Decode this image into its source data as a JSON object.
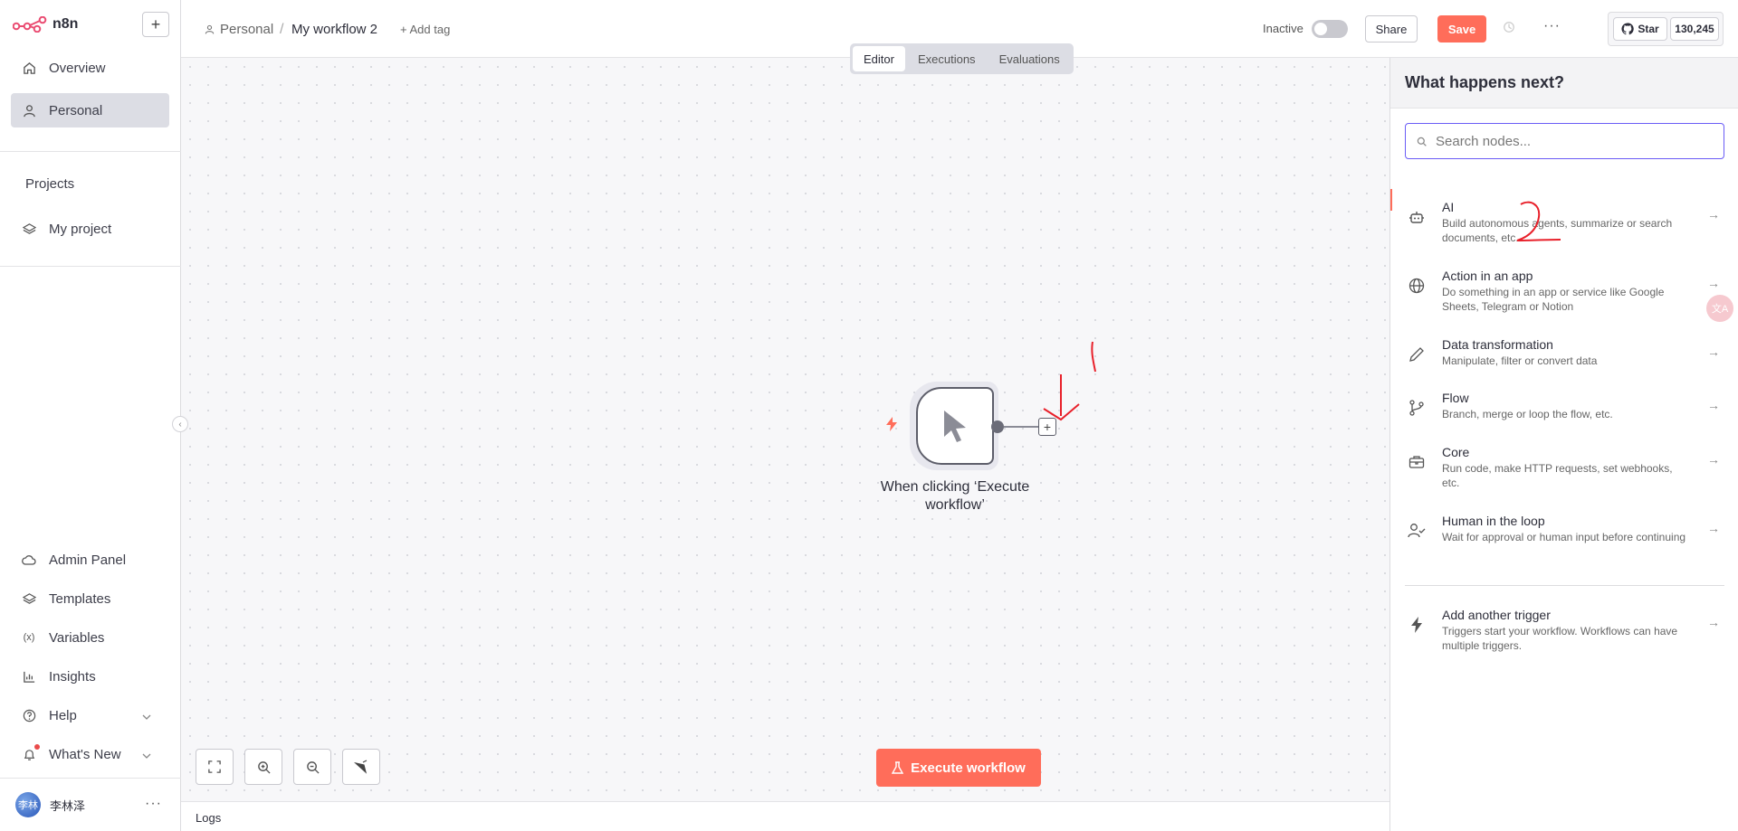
{
  "sidebar": {
    "logo_text": "n8n",
    "new_button": "+",
    "overview": "Overview",
    "personal": "Personal",
    "projects_heading": "Projects",
    "my_project": "My project",
    "admin_panel": "Admin Panel",
    "templates": "Templates",
    "variables": "Variables",
    "insights": "Insights",
    "help": "Help",
    "whats_new": "What's New",
    "user_name": "李林泽",
    "user_initials": "李林"
  },
  "header": {
    "crumb_personal": "Personal",
    "crumb_separator": "/",
    "workflow_name": "My workflow 2",
    "add_tag": "+ Add tag",
    "status": "Inactive",
    "share": "Share",
    "save": "Save",
    "github_star": "Star",
    "github_count": "130,245"
  },
  "tabs": [
    "Editor",
    "Executions",
    "Evaluations"
  ],
  "canvas": {
    "node_label": "When clicking ‘Execute workflow’",
    "execute_button": "Execute workflow"
  },
  "logs": {
    "label": "Logs"
  },
  "panel": {
    "title": "What happens next?",
    "search_placeholder": "Search nodes...",
    "categories": [
      {
        "title": "AI",
        "desc": "Build autonomous agents, summarize or search documents, etc."
      },
      {
        "title": "Action in an app",
        "desc": "Do something in an app or service like Google Sheets, Telegram or Notion"
      },
      {
        "title": "Data transformation",
        "desc": "Manipulate, filter or convert data"
      },
      {
        "title": "Flow",
        "desc": "Branch, merge or loop the flow, etc."
      },
      {
        "title": "Core",
        "desc": "Run code, make HTTP requests, set webhooks, etc."
      },
      {
        "title": "Human in the loop",
        "desc": "Wait for approval or human input before continuing"
      }
    ],
    "trigger": {
      "title": "Add another trigger",
      "desc": "Triggers start your workflow. Workflows can have multiple triggers."
    }
  },
  "translate_fab": "文A",
  "colors": {
    "accent": "#ff6d5a",
    "focus": "#6a5cf6",
    "annotation": "#e8202a"
  }
}
